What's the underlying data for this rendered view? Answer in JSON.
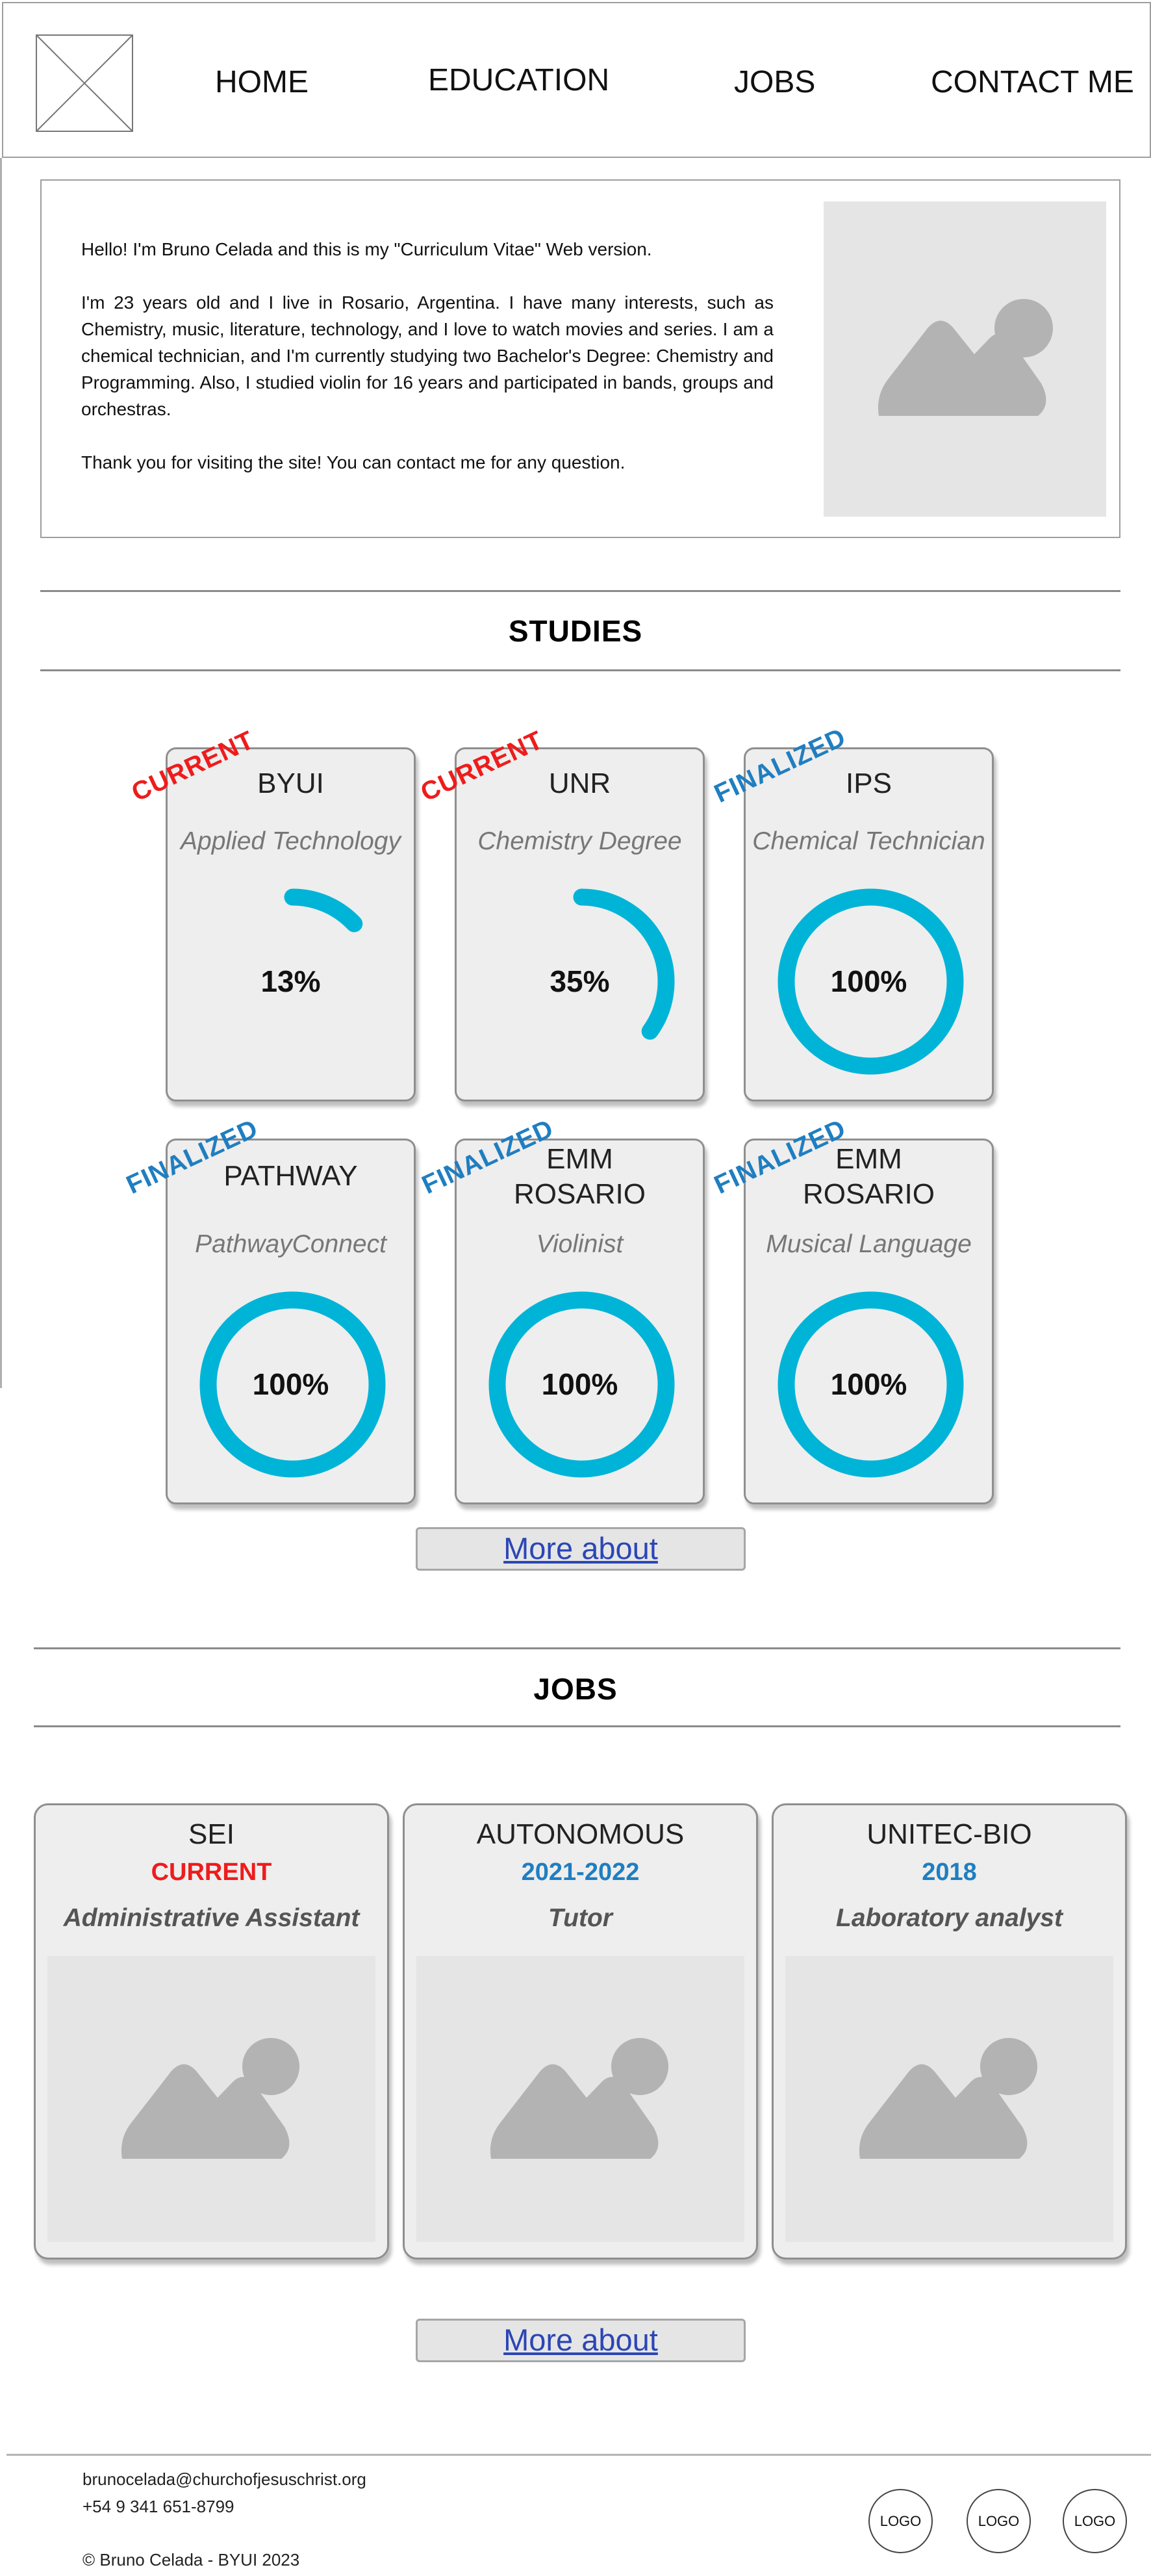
{
  "nav": {
    "home": "HOME",
    "education": "EDUCATION",
    "jobs": "JOBS",
    "contact": "CONTACT ME"
  },
  "intro": {
    "p1": "Hello! I'm Bruno Celada and this is my \"Curriculum Vitae\" Web version.",
    "p2": "I'm 23 years old and I live in Rosario, Argentina. I have many interests, such as Chemistry, music, literature, technology, and I love to watch movies and series. I am a chemical technician, and I'm currently studying two Bachelor's Degree: Chemistry and Programming. Also, I studied violin for 16 years and participated in bands, groups and orchestras.",
    "p3": "Thank you for visiting the site! You can contact me for any question."
  },
  "studies": {
    "title": "STUDIES",
    "more_label": "More about",
    "cards": [
      {
        "name": "BYUI",
        "subtitle": "Applied Technology",
        "percent": 13,
        "percent_label": "13%",
        "status": "CURRENT"
      },
      {
        "name": "UNR",
        "subtitle": "Chemistry Degree",
        "percent": 35,
        "percent_label": "35%",
        "status": "CURRENT"
      },
      {
        "name": "IPS",
        "subtitle": "Chemical Technician",
        "percent": 100,
        "percent_label": "100%",
        "status": "FINALIZED"
      },
      {
        "name": "PATHWAY",
        "subtitle": "PathwayConnect",
        "percent": 100,
        "percent_label": "100%",
        "status": "FINALIZED"
      },
      {
        "name_line1": "EMM",
        "name_line2": "ROSARIO",
        "subtitle": "Violinist",
        "percent": 100,
        "percent_label": "100%",
        "status": "FINALIZED"
      },
      {
        "name_line1": "EMM",
        "name_line2": "ROSARIO",
        "subtitle": "Musical Language",
        "percent": 100,
        "percent_label": "100%",
        "status": "FINALIZED"
      }
    ]
  },
  "jobs": {
    "title": "JOBS",
    "more_label": "More about",
    "cards": [
      {
        "name": "SEI",
        "period": "CURRENT",
        "role": "Administrative Assistant"
      },
      {
        "name": "AUTONOMOUS",
        "period": "2021-2022",
        "role": "Tutor"
      },
      {
        "name": "UNITEC-BIO",
        "period": "2018",
        "role": "Laboratory analyst"
      }
    ]
  },
  "footer": {
    "email": "brunocelada@churchofjesuschrist.org",
    "phone": "+54 9 341 651-8799",
    "copyright": "© Bruno Celada - BYUI 2023",
    "logos": [
      "LOGO",
      "LOGO",
      "LOGO"
    ]
  },
  "colors": {
    "accent": "#00b4d8",
    "current": "#ee1c1c",
    "finalized": "#1f7ec1",
    "placeholder_bg": "#e5e5e5",
    "placeholder_shape": "#b3b3b3",
    "link": "#2b46b6"
  },
  "icons": {
    "logo_placeholder": "crossed-box-icon",
    "image_placeholder": "mountain-image-icon"
  }
}
